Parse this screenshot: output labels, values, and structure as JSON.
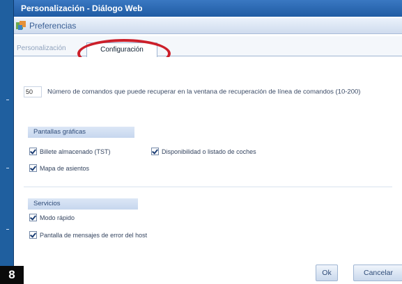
{
  "window": {
    "title": "Personalización - Diálogo Web"
  },
  "preferences": {
    "title": "Preferencias"
  },
  "tabs": [
    {
      "label": "Personalización"
    },
    {
      "label": "Configuración"
    }
  ],
  "limit": {
    "value": "50",
    "description": "Número de comandos que puede recuperar en la ventana de recuperación de línea de comandos (10-200)"
  },
  "graphic_panels": {
    "title": "Pantallas gráficas",
    "items": [
      {
        "label": "Billete almacenado (TST)"
      },
      {
        "label": "Disponibilidad o listado de coches"
      },
      {
        "label": "Mapa de asientos"
      }
    ]
  },
  "services": {
    "title": "Servicios",
    "items": [
      {
        "label": "Modo rápido"
      },
      {
        "label": "Pantalla de mensajes de error del host"
      }
    ]
  },
  "buttons": {
    "ok": "Ok",
    "cancel": "Cancelar"
  },
  "step": "8",
  "colors": {
    "highlight": "#cc1f2a",
    "accent": "#1f5f9f"
  }
}
